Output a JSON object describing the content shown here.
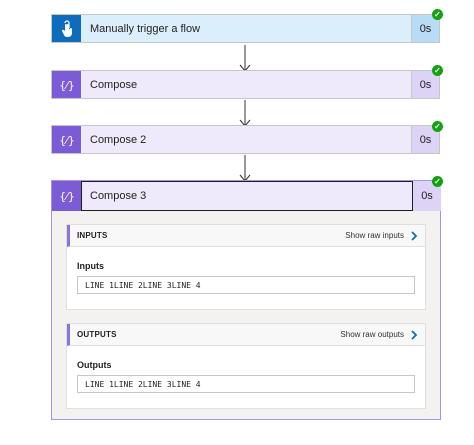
{
  "steps": [
    {
      "title": "Manually trigger a flow",
      "duration": "0s",
      "icon": "touch-trigger-icon",
      "status": "succeeded"
    },
    {
      "title": "Compose",
      "duration": "0s",
      "icon": "compose-braces-icon",
      "status": "succeeded"
    },
    {
      "title": "Compose 2",
      "duration": "0s",
      "icon": "compose-braces-icon",
      "status": "succeeded"
    },
    {
      "title": "Compose 3",
      "duration": "0s",
      "icon": "compose-braces-icon",
      "status": "succeeded"
    }
  ],
  "details": {
    "inputs": {
      "header": "INPUTS",
      "raw_link": "Show raw inputs",
      "field_label": "Inputs",
      "value": "LINE 1LINE 2LINE 3LINE 4"
    },
    "outputs": {
      "header": "OUTPUTS",
      "raw_link": "Show raw outputs",
      "field_label": "Outputs",
      "value": "LINE 1LINE 2LINE 3LINE 4"
    }
  },
  "colors": {
    "trigger": "#0f6cbd",
    "compose": "#7c5bd6",
    "success": "#13a10e"
  }
}
